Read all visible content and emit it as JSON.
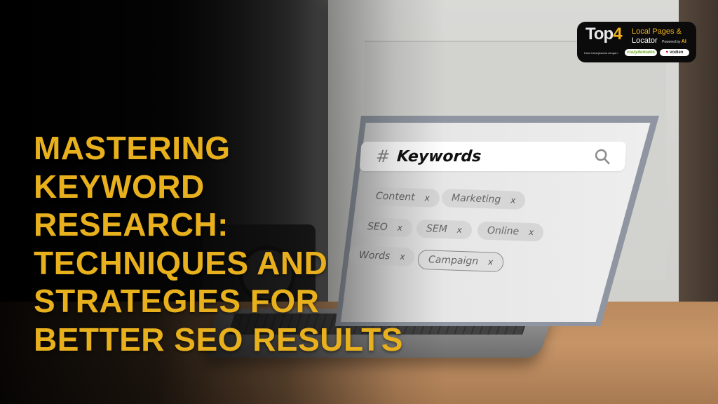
{
  "headline": {
    "lines": [
      "MASTERING",
      "KEYWORD",
      "RESEARCH:",
      "TECHNIQUES AND",
      "STRATEGIES FOR",
      "BETTER SEO RESULTS"
    ],
    "color": "#e8b01c"
  },
  "laptop_screen": {
    "search": {
      "prefix": "#",
      "value": "Keywords",
      "icon": "search-icon"
    },
    "tags": [
      {
        "label": "Content",
        "remove": "x"
      },
      {
        "label": "Marketing",
        "remove": "x"
      },
      {
        "label": "SEO",
        "remove": "x"
      },
      {
        "label": "SEM",
        "remove": "x"
      },
      {
        "label": "Online",
        "remove": "x"
      },
      {
        "label": "Words",
        "remove": "x"
      },
      {
        "label": "Campaign",
        "remove": "x"
      }
    ]
  },
  "badge": {
    "brand_main": "Top",
    "brand_num": "4",
    "line1": "Local Pages &",
    "line2": "Locator",
    "powered_prefix": "Powered by",
    "powered_ai": "AI",
    "partner_label": "Kami bekerjasama dengan:",
    "partners": [
      "crazydomains",
      "vodien"
    ],
    "accent": "#f2b31b"
  }
}
